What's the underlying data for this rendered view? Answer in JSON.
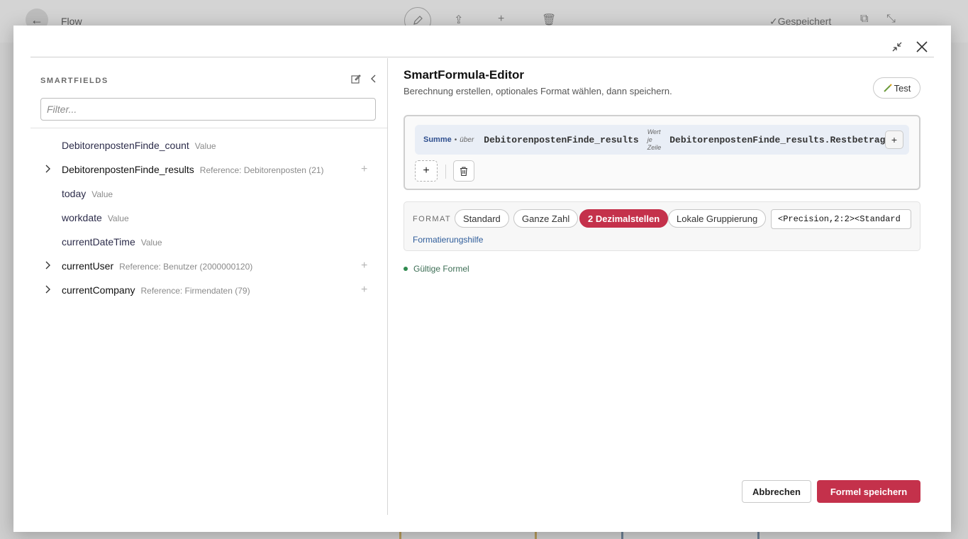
{
  "background": {
    "title": "Flow",
    "saved_label": "Gespeichert"
  },
  "smartfields": {
    "title": "SMARTFIELDS",
    "filter_placeholder": "Filter...",
    "items": [
      {
        "name": "DebitorenpostenFinde_count",
        "kind": "Value",
        "expandable": false
      },
      {
        "name": "DebitorenpostenFinde_results",
        "kind": "Reference: Debitorenposten (21)",
        "expandable": true
      },
      {
        "name": "today",
        "kind": "Value",
        "expandable": false
      },
      {
        "name": "workdate",
        "kind": "Value",
        "expandable": false
      },
      {
        "name": "currentDateTime",
        "kind": "Value",
        "expandable": false
      },
      {
        "name": "currentUser",
        "kind": "Reference: Benutzer (2000000120)",
        "expandable": true
      },
      {
        "name": "currentCompany",
        "kind": "Reference: Firmendaten (79)",
        "expandable": true
      }
    ]
  },
  "editor": {
    "title": "SmartFormula-Editor",
    "subtitle": "Berechnung erstellen, optionales Format wählen, dann speichern.",
    "test_label": "Test",
    "formula": {
      "aggregate": "Summe",
      "dot": "•",
      "over": "über",
      "source": "DebitorenpostenFinde_results",
      "per_row_line1": "Wert",
      "per_row_line2": "je",
      "per_row_line3": "Zeile",
      "field": "DebitorenpostenFinde_results.Restbetrag",
      "plus": "+"
    },
    "add_label": "+",
    "format": {
      "label": "FORMAT",
      "chips": [
        "Standard",
        "Ganze Zahl",
        "2 Dezimalstellen",
        "Lokale Gruppierung"
      ],
      "active_chip": "2 Dezimalstellen",
      "value": "<Precision,2:2><Standard",
      "help": "Formatierungshilfe"
    },
    "status": "Gültige Formel"
  },
  "footer": {
    "cancel": "Abbrechen",
    "save": "Formel speichern"
  },
  "colors": {
    "accent": "#c4314b",
    "link": "#2f5d9a",
    "valid": "#2f8a4f"
  }
}
